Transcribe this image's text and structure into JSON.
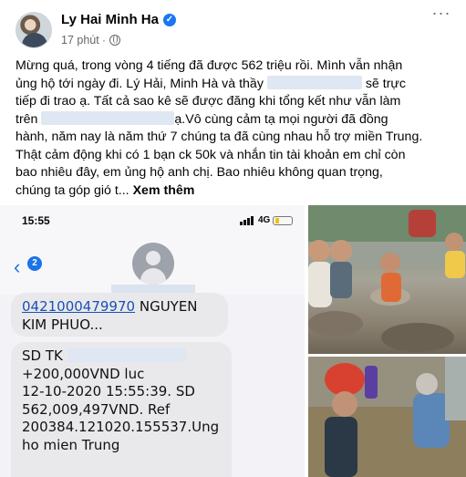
{
  "post": {
    "author": "Ly Hai Minh Ha",
    "timestamp": "17 phút",
    "dot": "·",
    "more_label": "···",
    "text": {
      "line1": "Mừng quá, trong vòng 4 tiếng đã được 562 triệu rồi. Mình vẫn nhận",
      "line2": "ủng hộ tới ngày đi. Lý Hải, Minh Hà và thầy",
      "line2b": "sẽ trực",
      "line3": "tiếp đi trao ạ. Tất cả sao kê sẽ được đăng khi tổng kết như vẫn làm",
      "line4a": "trên",
      "line4b": "ạ.Vô cùng cảm tạ mọi người đã đồng",
      "line5": "hành, năm nay là năm thứ 7 chúng ta đã cùng nhau hỗ trợ miền Trung.",
      "line6": "Thật cảm động khi có 1 bạn ck 50k và nhắn tin tài khoản em chỉ còn",
      "line7": "bao nhiêu đây, em ủng hộ anh chị. Bao nhiêu không quan trọng,",
      "line8": "chúng ta góp gió t...",
      "see_more": "Xem thêm"
    }
  },
  "phone": {
    "clock": "15:55",
    "network": "4G",
    "back_arrow": "‹",
    "back_count": "2",
    "message1": {
      "account": "0421000479970",
      "name_line1": " NGUYEN",
      "name_line2": "KIM PHUO..."
    },
    "message2": {
      "line1": "SD TK",
      "line2": "+200,000VND luc",
      "line3": "12-10-2020 15:55:39. SD",
      "line4": "562,009,497VND. Ref",
      "line5": "200384.121020.155537.Ung",
      "line6": "ho mien Trung"
    }
  },
  "colors": {
    "verified": "#1877f2",
    "ios_blue": "#1a73e8",
    "bubble": "#e9e9eb",
    "secondary_text": "#65676b"
  },
  "icons": [
    "verified-badge-icon",
    "globe-icon",
    "more-options-icon",
    "signal-icon",
    "battery-icon",
    "back-arrow-icon",
    "contact-avatar-icon"
  ]
}
